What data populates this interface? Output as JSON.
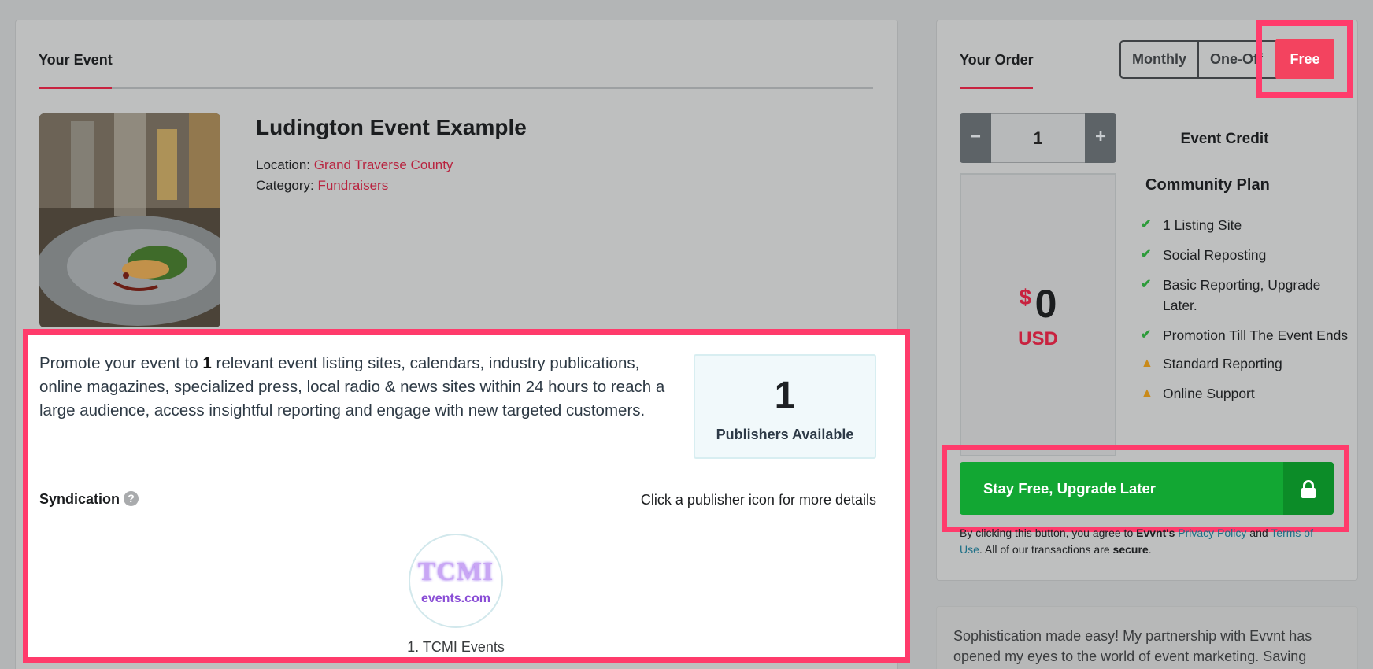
{
  "event_panel": {
    "tab_label": "Your Event",
    "title": "Ludington Event Example",
    "location_label": "Location:",
    "location_value": "Grand Traverse County",
    "category_label": "Category:",
    "category_value": "Fundraisers",
    "photo_alt": "plated food photo"
  },
  "promo": {
    "text_before": "Promote your event to ",
    "count": "1",
    "text_after": " relevant event listing sites, calendars, industry publications, online magazines, specialized press, local radio & news sites within 24 hours to reach a large audience, access insightful reporting and engage with new targeted customers.",
    "publishers_count": "1",
    "publishers_label": "Publishers Available",
    "syndication_label": "Syndication",
    "help_glyph": "?",
    "click_hint": "Click a publisher icon for more details",
    "publisher_logo_top": "TCMI",
    "publisher_logo_bottom": "events.com",
    "publisher_name": "1. TCMI Events"
  },
  "order_panel": {
    "tab_label": "Your Order",
    "billing": {
      "monthly": "Monthly",
      "one_off": "One-Off",
      "free": "Free",
      "selected": "Free"
    },
    "quantity": {
      "minus": "−",
      "value": "1",
      "plus": "+"
    },
    "credit_label": "Event Credit",
    "price": {
      "symbol": "$",
      "amount": "0",
      "currency": "USD"
    },
    "plan_name": "Community Plan",
    "features": [
      {
        "icon": "check-icon",
        "text": "1 Listing Site"
      },
      {
        "icon": "check-icon",
        "text": "Social Reposting"
      },
      {
        "icon": "check-icon",
        "text": "Basic Reporting, Upgrade Later."
      },
      {
        "icon": "check-icon",
        "text": "Promotion Till The Event Ends"
      },
      {
        "icon": "warning-icon",
        "text": "Standard Reporting"
      },
      {
        "icon": "warning-icon",
        "text": "Online Support"
      }
    ],
    "cta_label": "Stay Free, Upgrade Later",
    "legal": {
      "prefix": "By clicking this button, you agree to ",
      "brand": "Evvnt's",
      "privacy": "Privacy Policy",
      "and": " and ",
      "terms": "Terms of Use",
      "middle": ". All of our transactions are ",
      "secure": "secure",
      "end": "."
    }
  },
  "testimonial": {
    "text": "Sophistication made easy! My partnership with Evvnt has opened my eyes to the world of event marketing. Saving"
  },
  "colors": {
    "accent_red": "#c8223f",
    "highlight_pink": "#ff3b6b",
    "free_button": "#f3435f",
    "cta_green": "#12a733"
  }
}
